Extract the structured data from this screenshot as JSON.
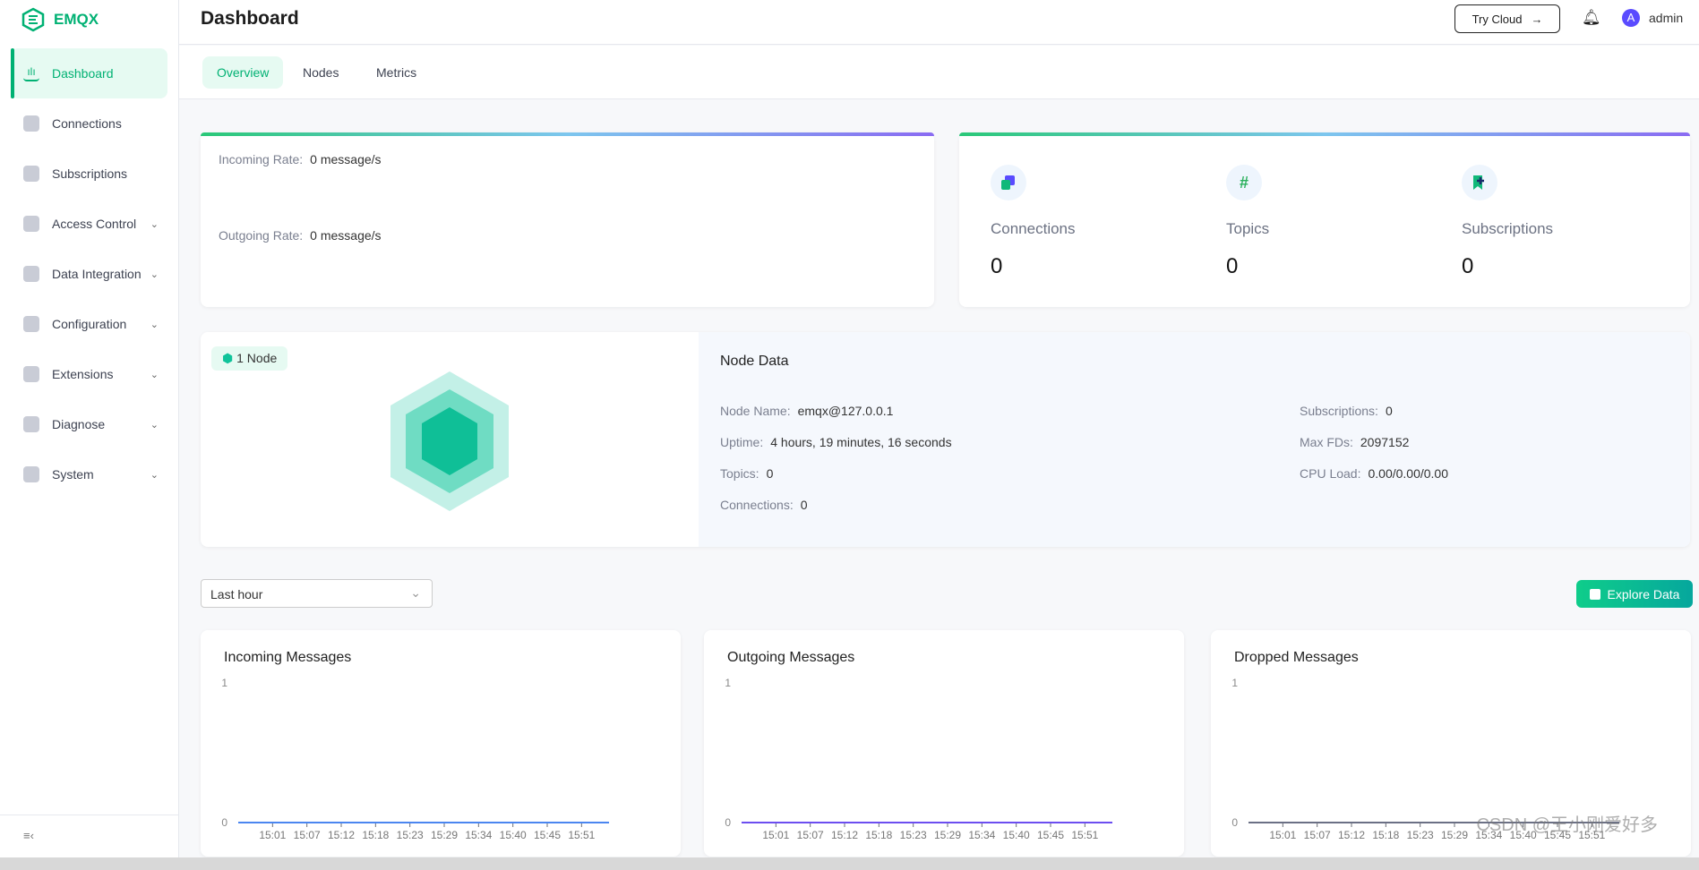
{
  "app": {
    "logo": "EMQX",
    "title": "Dashboard"
  },
  "sidebar": {
    "items": [
      {
        "label": "Dashboard",
        "active": true,
        "icon": "bar-chart-icon",
        "expandable": false
      },
      {
        "label": "Connections",
        "icon": "connections-icon",
        "expandable": false
      },
      {
        "label": "Subscriptions",
        "icon": "bookmark-plus-icon",
        "expandable": false
      },
      {
        "label": "Access Control",
        "icon": "shield-icon",
        "expandable": true
      },
      {
        "label": "Data Integration",
        "icon": "database-icon",
        "expandable": true
      },
      {
        "label": "Configuration",
        "icon": "gear-icon",
        "expandable": true
      },
      {
        "label": "Extensions",
        "icon": "puzzle-icon",
        "expandable": true
      },
      {
        "label": "Diagnose",
        "icon": "diagnose-icon",
        "expandable": true
      },
      {
        "label": "System",
        "icon": "stack-icon",
        "expandable": true
      }
    ],
    "collapse": "≡‹"
  },
  "header": {
    "try_cloud": "Try Cloud",
    "arrow": "→",
    "avatar": "A",
    "user": "admin"
  },
  "tabs": [
    {
      "label": "Overview",
      "active": true
    },
    {
      "label": "Nodes"
    },
    {
      "label": "Metrics"
    }
  ],
  "rates": {
    "incoming_label": "Incoming Rate:",
    "incoming_value": "0 message/s",
    "outgoing_label": "Outgoing Rate:",
    "outgoing_value": "0 message/s"
  },
  "stats": [
    {
      "label": "Connections",
      "value": "0"
    },
    {
      "label": "Topics",
      "value": "0",
      "icon": "#"
    },
    {
      "label": "Subscriptions",
      "value": "0"
    }
  ],
  "node": {
    "badge": "1 Node",
    "title": "Node Data",
    "left": [
      {
        "k": "Node Name:",
        "v": "emqx@127.0.0.1"
      },
      {
        "k": "Uptime:",
        "v": "4 hours, 19 minutes, 16 seconds"
      },
      {
        "k": "Topics:",
        "v": "0"
      },
      {
        "k": "Connections:",
        "v": "0"
      }
    ],
    "right": [
      {
        "k": "Subscriptions:",
        "v": "0"
      },
      {
        "k": "Max FDs:",
        "v": "2097152"
      },
      {
        "k": "CPU Load:",
        "v": "0.00/0.00/0.00"
      }
    ]
  },
  "filter": {
    "range": "Last hour",
    "explore": "Explore Data"
  },
  "chart_data": [
    {
      "type": "line",
      "title": "Incoming Messages",
      "categories": [
        "15:01",
        "15:07",
        "15:12",
        "15:18",
        "15:23",
        "15:29",
        "15:34",
        "15:40",
        "15:45",
        "15:51"
      ],
      "values": [
        0,
        0,
        0,
        0,
        0,
        0,
        0,
        0,
        0,
        0
      ],
      "yticks": [
        "0",
        "1"
      ],
      "ylim": [
        0,
        1
      ],
      "color": "#4b86f0"
    },
    {
      "type": "line",
      "title": "Outgoing Messages",
      "categories": [
        "15:01",
        "15:07",
        "15:12",
        "15:18",
        "15:23",
        "15:29",
        "15:34",
        "15:40",
        "15:45",
        "15:51"
      ],
      "values": [
        0,
        0,
        0,
        0,
        0,
        0,
        0,
        0,
        0,
        0
      ],
      "yticks": [
        "0",
        "1"
      ],
      "ylim": [
        0,
        1
      ],
      "color": "#6c4ef0"
    },
    {
      "type": "line",
      "title": "Dropped Messages",
      "categories": [
        "15:01",
        "15:07",
        "15:12",
        "15:18",
        "15:23",
        "15:29",
        "15:34",
        "15:40",
        "15:45",
        "15:51"
      ],
      "values": [
        0,
        0,
        0,
        0,
        0,
        0,
        0,
        0,
        0,
        0
      ],
      "yticks": [
        "0",
        "1"
      ],
      "ylim": [
        0,
        1
      ],
      "color": "#6b7085"
    }
  ],
  "watermark": "CSDN @王小刚爱好多"
}
